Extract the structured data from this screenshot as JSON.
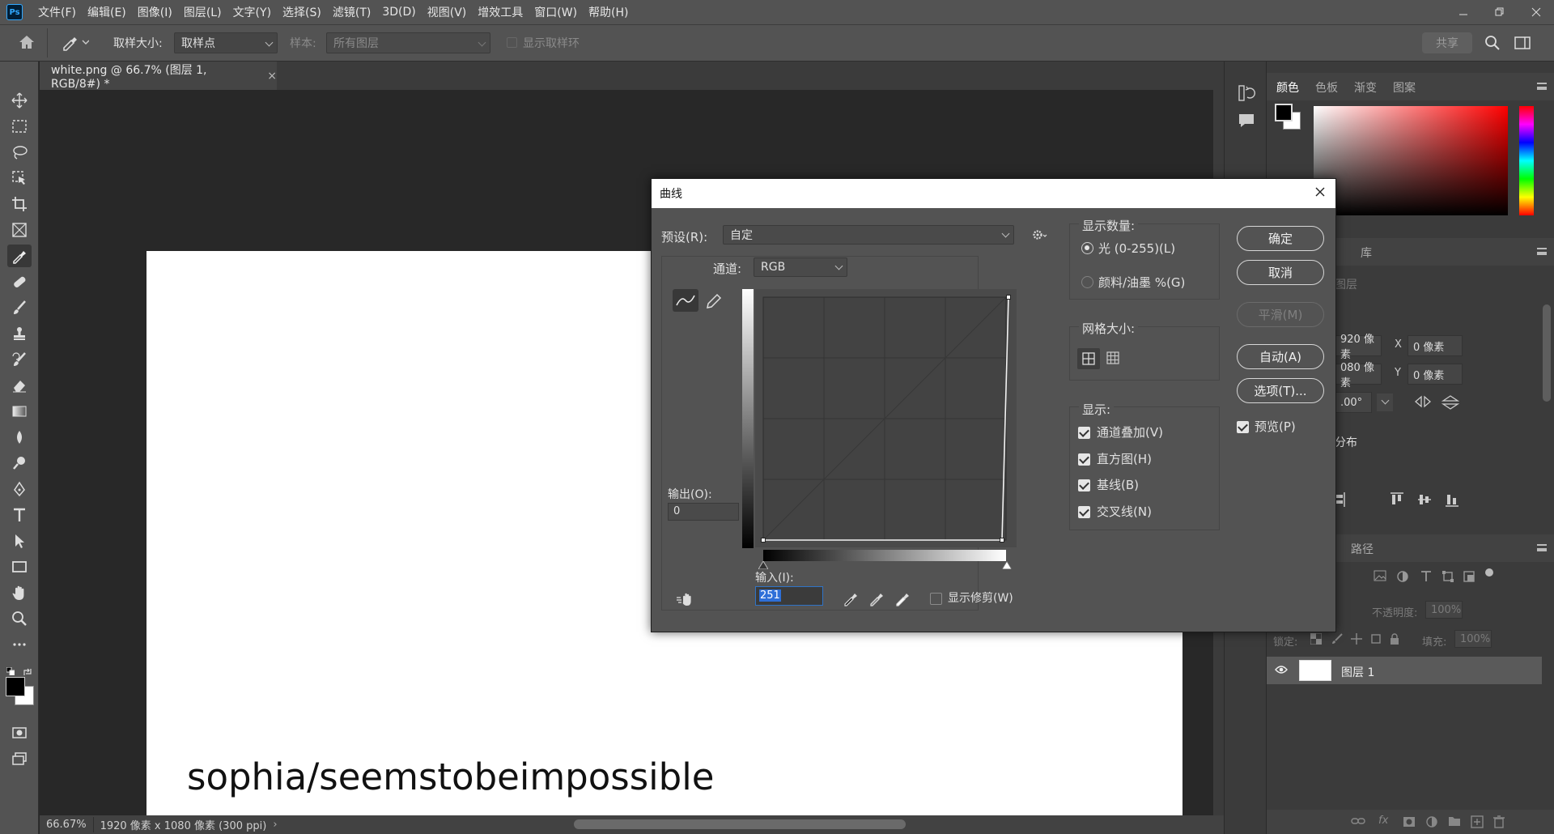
{
  "app": {
    "logo": "Ps"
  },
  "menu": [
    "文件(F)",
    "编辑(E)",
    "图像(I)",
    "图层(L)",
    "文字(Y)",
    "选择(S)",
    "滤镜(T)",
    "3D(D)",
    "视图(V)",
    "增效工具",
    "窗口(W)",
    "帮助(H)"
  ],
  "options": {
    "sample_size_label": "取样大小:",
    "sample_size_value": "取样点",
    "sample_label": "样本:",
    "sample_value": "所有图层",
    "show_ring_label": "显示取样环",
    "share_label": "共享"
  },
  "document": {
    "tab_title": "white.png @ 66.7% (图层 1, RGB/8#) *",
    "canvas_text": "sophia/seemstobeimpossible",
    "zoom": "66.67%",
    "dimensions": "1920 像素 x 1080 像素 (300 ppi)"
  },
  "color_panel": {
    "tabs": [
      "颜色",
      "色板",
      "渐变",
      "图案"
    ],
    "foreground": "#000000",
    "background": "#ffffff"
  },
  "properties_panel": {
    "tab_partial": "库",
    "section_layer": "图层",
    "w": "920 像素",
    "h": "080 像素",
    "x_label": "X",
    "x": "0 像素",
    "y_label": "Y",
    "y": "0 像素",
    "angle": ".00°",
    "distribute": "分布"
  },
  "layers_panel": {
    "tab_paths": "路径",
    "opacity_label": "不透明度:",
    "opacity": "100%",
    "lock_label": "锁定:",
    "fill_label": "填充:",
    "fill": "100%",
    "layer_name": "图层 1"
  },
  "curves": {
    "title": "曲线",
    "preset_label": "预设(R):",
    "preset_value": "自定",
    "channel_label": "通道:",
    "channel_value": "RGB",
    "output_label": "输出(O):",
    "output_value": "0",
    "input_label": "输入(I):",
    "input_value": "251",
    "show_clipping_label": "显示修剪(W)",
    "show_amount_label": "显示数量:",
    "light_label": "光 (0-255)(L)",
    "pigment_label": "颜料/油墨 %(G)",
    "grid_size_label": "网格大小:",
    "show_label": "显示:",
    "channel_overlay_label": "通道叠加(V)",
    "histogram_label": "直方图(H)",
    "baseline_label": "基线(B)",
    "intersection_label": "交叉线(N)",
    "ok_label": "确定",
    "cancel_label": "取消",
    "smooth_label": "平滑(M)",
    "auto_label": "自动(A)",
    "options_label": "选项(T)...",
    "preview_label": "预览(P)"
  }
}
